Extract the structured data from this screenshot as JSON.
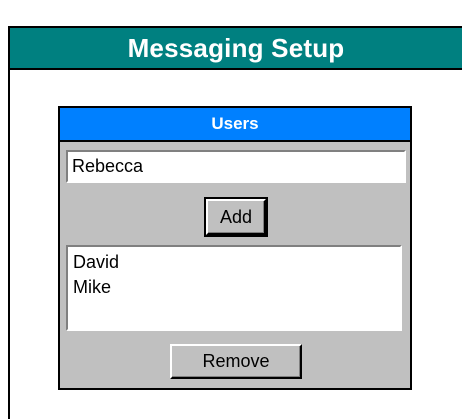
{
  "window": {
    "title": "Messaging Setup"
  },
  "users_panel": {
    "header": "Users",
    "name_input": {
      "value": "Rebecca",
      "placeholder": ""
    },
    "add_label": "Add",
    "list": [
      {
        "label": "David"
      },
      {
        "label": "Mike"
      }
    ],
    "remove_label": "Remove"
  },
  "colors": {
    "title_bar": "#008080",
    "panel_header": "#0080ff",
    "panel_background": "#c0c0c0"
  }
}
